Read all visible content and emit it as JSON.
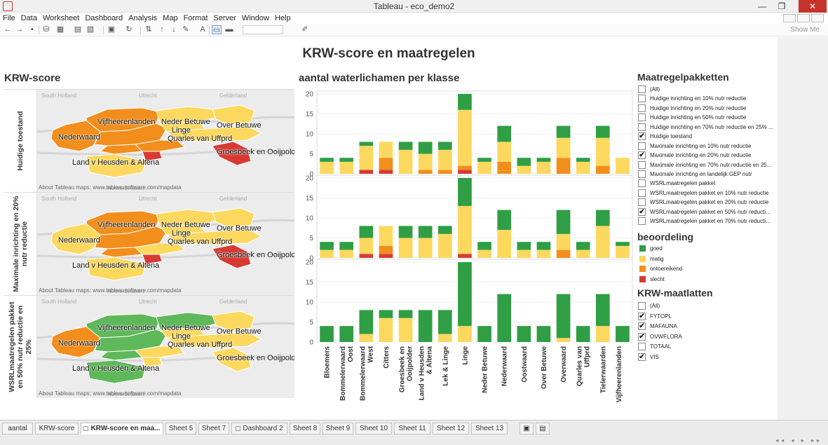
{
  "window": {
    "title": "Tableau - eco_demo2"
  },
  "menu": [
    "File",
    "Data",
    "Worksheet",
    "Dashboard",
    "Analysis",
    "Map",
    "Format",
    "Server",
    "Window",
    "Help"
  ],
  "toolbar": {
    "show_me": "Show Me"
  },
  "dashboard": {
    "title": "KRW-score  en maatregelen",
    "map_title": "KRW-score",
    "bar_title": "aantal waterlichamen per klasse",
    "map_rows": [
      {
        "label": "Huidige toestand"
      },
      {
        "label": "Maximale inrichting en 20% nutr reductie"
      },
      {
        "label": "WSRLmaatregelen pakket en 50% nutr reductie en 25%"
      }
    ],
    "map_labels": [
      "Vijfheerenlanden",
      "Neder Betuwe",
      "Linge",
      "Over Betuwe",
      "Nederwaard",
      "Quarles van Uffprd",
      "Groesbeek en Ooijpolder",
      "Land v Heusden & Altena"
    ],
    "map_background": {
      "south_holland": "South Holland",
      "utrecht": "Utrecht",
      "gelderland": "Gelderland",
      "noord_brabant": "Noord-Brabant"
    },
    "map_attribution": "About Tableau maps: www.tableausoftware.com/mapdata"
  },
  "colors": {
    "goed": "#2f9e44",
    "matig": "#fcd85e",
    "ontoereikend": "#f28e1c",
    "slecht": "#d83a32"
  },
  "legends": {
    "maatregel_title": "Maatregelpakketten",
    "maatregel_items": [
      {
        "label": "(All)",
        "checked": false
      },
      {
        "label": "Huidige inrichting en 10% nutr reductie",
        "checked": false
      },
      {
        "label": "Huidige inrichting en 20% nutr reductie",
        "checked": false
      },
      {
        "label": "Huidige inrichting en 50% nutr reductie",
        "checked": false
      },
      {
        "label": "Huidige inrichting en 70% nutr reductie en 25% ...",
        "checked": false
      },
      {
        "label": "Huidige toestand",
        "checked": true
      },
      {
        "label": "Maximale inrichting en 10% nutr reductie",
        "checked": false
      },
      {
        "label": "Maximale inrichting en 20% nutr reductie",
        "checked": true
      },
      {
        "label": "Maximale inrichting en 70% nutr reductie en 25...",
        "checked": false
      },
      {
        "label": "Maximale inrichting en landelijk GEP nutr",
        "checked": false
      },
      {
        "label": "WSRLmaatregelen pakket",
        "checked": false
      },
      {
        "label": "WSRLmaatregelen pakket en 10% nutr reductie",
        "checked": false
      },
      {
        "label": "WSRLmaatregelen pakket en 20% nutr reductie",
        "checked": false
      },
      {
        "label": "WSRLmaatregelen pakket en 50% nutr reducti...",
        "checked": true
      },
      {
        "label": "WSRLmaatregelen pakket en 70% nutr reducti...",
        "checked": false
      }
    ],
    "beoordeling_title": "beoordeling",
    "beoordeling_items": [
      {
        "label": "goed",
        "color": "#2f9e44"
      },
      {
        "label": "matig",
        "color": "#fcd85e"
      },
      {
        "label": "ontoereikend",
        "color": "#f28e1c"
      },
      {
        "label": "slecht",
        "color": "#d83a32"
      }
    ],
    "krw_title": "KRW-maatlatten",
    "krw_items": [
      {
        "label": "(All)",
        "checked": false
      },
      {
        "label": "FYTOPL",
        "checked": true
      },
      {
        "label": "MAFAUNA",
        "checked": true
      },
      {
        "label": "OVWFLORA",
        "checked": true
      },
      {
        "label": "TOTAAL",
        "checked": false
      },
      {
        "label": "VIS",
        "checked": true
      }
    ]
  },
  "tabs": [
    {
      "label": "aantal",
      "active": false,
      "icon": false
    },
    {
      "label": "KRW-score",
      "active": false,
      "icon": false
    },
    {
      "label": "KRW-score  en maa...",
      "active": true,
      "icon": true
    },
    {
      "label": "Sheet 5",
      "active": false,
      "icon": false
    },
    {
      "label": "Sheet 7",
      "active": false,
      "icon": false
    },
    {
      "label": "Dashboard 2",
      "active": false,
      "icon": true
    },
    {
      "label": "Sheet 8",
      "active": false,
      "icon": false
    },
    {
      "label": "Sheet 9",
      "active": false,
      "icon": false
    },
    {
      "label": "Sheet 10",
      "active": false,
      "icon": false
    },
    {
      "label": "Sheet 11",
      "active": false,
      "icon": false
    },
    {
      "label": "Sheet 12",
      "active": false,
      "icon": false
    },
    {
      "label": "Sheet 13",
      "active": false,
      "icon": false
    }
  ],
  "chart_data": {
    "type": "bar",
    "stacked": true,
    "panels": [
      "Huidige toestand",
      "Maximale inrichting en 20% nutr reductie",
      "WSRLmaatregelen pakket en 50% nutr reductie en 25%"
    ],
    "categories": [
      "Bloemers",
      "Bommelerwaard Oost",
      "Bommelerwaard West",
      "Citters",
      "Groesbeek en Ooijpolder",
      "Land v Heusden & Altena",
      "Lek & Linge",
      "Linge",
      "Neder Betuwe",
      "Nederwaard",
      "Oostwaard",
      "Over Betuwe",
      "Overwaard",
      "Quarles van Uffprd",
      "Tielerwaarden",
      "Vijfheerenlanden"
    ],
    "yticks": [
      0,
      5,
      10,
      15,
      20
    ],
    "ylim": [
      0,
      20
    ],
    "series_order": [
      "slecht",
      "ontoereikend",
      "matig",
      "goed"
    ],
    "values": [
      {
        "slecht": [
          0,
          0,
          1,
          1,
          0,
          0,
          0,
          1,
          0,
          0,
          0,
          0,
          0,
          0,
          0,
          0
        ],
        "ontoereikend": [
          0,
          0,
          0,
          3,
          0,
          1,
          1,
          1,
          0,
          3,
          0,
          0,
          4,
          0,
          2,
          0
        ],
        "matig": [
          3,
          3,
          6,
          4,
          6,
          4,
          5,
          14,
          3,
          5,
          2,
          3,
          5,
          3,
          7,
          4
        ],
        "goed": [
          1,
          1,
          1,
          0,
          2,
          3,
          2,
          4,
          1,
          4,
          2,
          1,
          3,
          1,
          3,
          0
        ]
      },
      {
        "slecht": [
          0,
          0,
          1,
          1,
          0,
          0,
          0,
          1,
          0,
          0,
          0,
          0,
          0,
          0,
          0,
          0
        ],
        "ontoereikend": [
          0,
          0,
          0,
          2,
          0,
          0,
          0,
          0,
          0,
          0,
          0,
          0,
          2,
          0,
          0,
          0
        ],
        "matig": [
          2,
          2,
          4,
          5,
          5,
          5,
          6,
          12,
          2,
          7,
          2,
          2,
          4,
          2,
          8,
          3
        ],
        "goed": [
          2,
          2,
          3,
          0,
          3,
          3,
          2,
          7,
          2,
          5,
          2,
          2,
          6,
          2,
          4,
          1
        ]
      },
      {
        "slecht": [
          0,
          0,
          0,
          0,
          0,
          0,
          0,
          0,
          0,
          0,
          0,
          0,
          0,
          0,
          0,
          0
        ],
        "ontoereikend": [
          0,
          0,
          0,
          0,
          0,
          0,
          0,
          0,
          0,
          0,
          0,
          0,
          0,
          0,
          0,
          0
        ],
        "matig": [
          0,
          0,
          2,
          6,
          6,
          0,
          2,
          4,
          0,
          0,
          0,
          0,
          1,
          0,
          4,
          0
        ],
        "goed": [
          4,
          4,
          6,
          2,
          2,
          8,
          6,
          16,
          4,
          12,
          4,
          4,
          11,
          4,
          8,
          4
        ]
      }
    ]
  },
  "map_colors": [
    {
      "Vijfheerenlanden": "#f28e1c",
      "Nederwaard": "#f28e1c",
      "Neder Betuwe": "#fcd85e",
      "Linge": "#fcd85e",
      "Over Betuwe": "#fcd85e",
      "Quarles van Uffprd": "#fcd85e",
      "Groesbeek en Ooijpolder": "#d83a32",
      "Land v Heusden & Altena": "#fcd85e",
      "Overwaard": "#f28e1c",
      "Tielerwaarden": "#f28e1c",
      "Lek & Linge": "#f28e1c",
      "Bommelerwaard": "#d83a32"
    },
    {
      "Vijfheerenlanden": "#f28e1c",
      "Nederwaard": "#fcd85e",
      "Neder Betuwe": "#fcd85e",
      "Linge": "#fcd85e",
      "Over Betuwe": "#fcd85e",
      "Quarles van Uffprd": "#fcd85e",
      "Groesbeek en Ooijpolder": "#d83a32",
      "Land v Heusden & Altena": "#fcd85e",
      "Overwaard": "#f28e1c",
      "Tielerwaarden": "#fcd85e",
      "Lek & Linge": "#f28e1c",
      "Bommelerwaard": "#d83a32"
    },
    {
      "Vijfheerenlanden": "#5fb85a",
      "Nederwaard": "#f28e1c",
      "Neder Betuwe": "#5fb85a",
      "Linge": "#fcd85e",
      "Over Betuwe": "#fcd85e",
      "Quarles van Uffprd": "#fcd85e",
      "Groesbeek en Ooijpolder": "#fcd85e",
      "Land v Heusden & Altena": "#5fb85a",
      "Overwaard": "#5fb85a",
      "Tielerwaarden": "#fcd85e",
      "Lek & Linge": "#5fb85a",
      "Bommelerwaard": "#fcd85e"
    }
  ]
}
